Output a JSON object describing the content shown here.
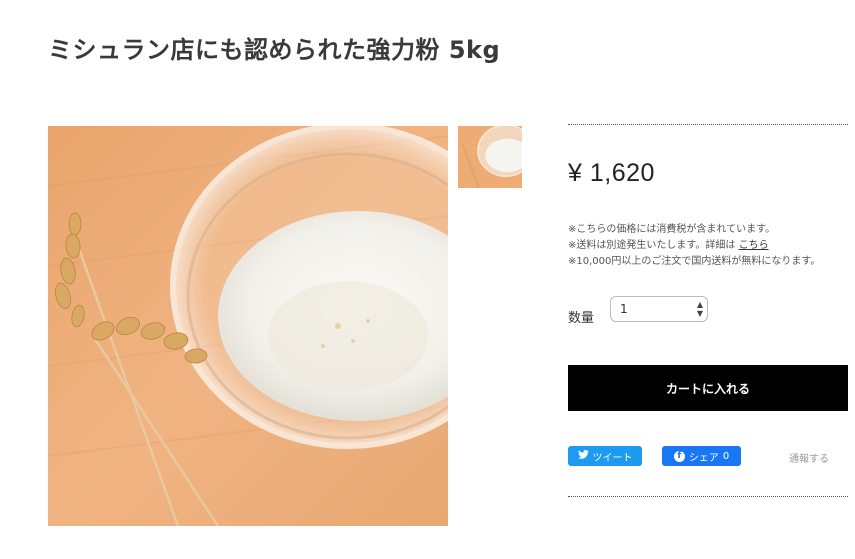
{
  "product": {
    "title": "ミシュラン店にも認められた強力粉 5kg",
    "price": "¥ 1,620",
    "main_image_alt": "",
    "thumbnail_alt": ""
  },
  "notes": {
    "line1": "※こちらの価格には消費税が含まれています。",
    "line2_prefix": "※送料は別途発生いたします。詳細は",
    "line2_link": "こちら",
    "line3": "※10,000円以上のご注文で国内送料が無料になります。"
  },
  "quantity": {
    "label": "数量",
    "value": "1"
  },
  "cart": {
    "label": "カートに入れる"
  },
  "social": {
    "tweet_label": "ツイート",
    "share_label": "シェア",
    "share_count": "0",
    "report_label": "通報する"
  },
  "colors": {
    "cart_bg": "#000000",
    "twitter": "#1d9bf0",
    "facebook": "#1877f2"
  }
}
